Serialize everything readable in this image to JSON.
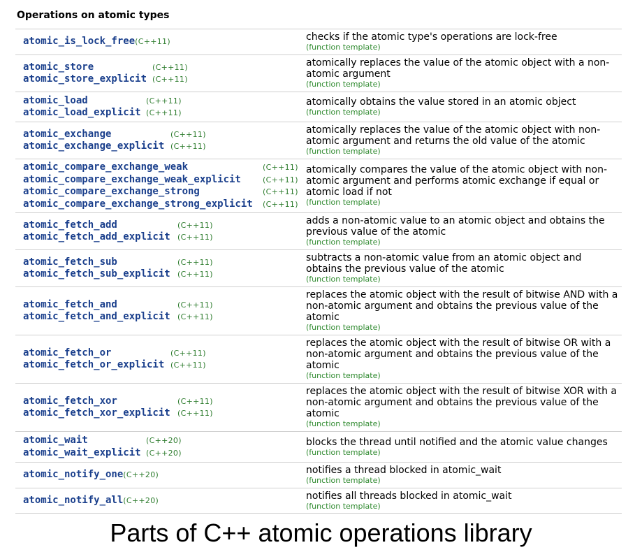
{
  "section_title": "Operations on atomic types",
  "caption": "Parts of C++ atomic operations library",
  "rows": [
    {
      "names": [
        {
          "fn": "atomic_is_lock_free",
          "ver": "(C++11)"
        }
      ],
      "desc": "checks if the atomic type's operations are lock-free",
      "kind": "(function template)"
    },
    {
      "names": [
        {
          "fn": "atomic_store",
          "ver": "(C++11)"
        },
        {
          "fn": "atomic_store_explicit",
          "ver": "(C++11)"
        }
      ],
      "desc": "atomically replaces the value of the atomic object with a non-atomic argument",
      "kind": "(function template)"
    },
    {
      "names": [
        {
          "fn": "atomic_load",
          "ver": "(C++11)"
        },
        {
          "fn": "atomic_load_explicit",
          "ver": "(C++11)"
        }
      ],
      "desc": "atomically obtains the value stored in an atomic object",
      "kind": "(function template)"
    },
    {
      "names": [
        {
          "fn": "atomic_exchange",
          "ver": "(C++11)"
        },
        {
          "fn": "atomic_exchange_explicit",
          "ver": "(C++11)"
        }
      ],
      "desc": "atomically replaces the value of the atomic object with non-atomic argument and returns the old value of the atomic",
      "kind": "(function template)"
    },
    {
      "names": [
        {
          "fn": "atomic_compare_exchange_weak",
          "ver": "(C++11)"
        },
        {
          "fn": "atomic_compare_exchange_weak_explicit",
          "ver": "(C++11)"
        },
        {
          "fn": "atomic_compare_exchange_strong",
          "ver": "(C++11)"
        },
        {
          "fn": "atomic_compare_exchange_strong_explicit",
          "ver": "(C++11)"
        }
      ],
      "desc": "atomically compares the value of the atomic object with non-atomic argument and performs atomic exchange if equal or atomic load if not",
      "kind": "(function template)"
    },
    {
      "names": [
        {
          "fn": "atomic_fetch_add",
          "ver": "(C++11)"
        },
        {
          "fn": "atomic_fetch_add_explicit",
          "ver": "(C++11)"
        }
      ],
      "desc": "adds a non-atomic value to an atomic object and obtains the previous value of the atomic",
      "kind": "(function template)"
    },
    {
      "names": [
        {
          "fn": "atomic_fetch_sub",
          "ver": "(C++11)"
        },
        {
          "fn": "atomic_fetch_sub_explicit",
          "ver": "(C++11)"
        }
      ],
      "desc": "subtracts a non-atomic value from an atomic object and obtains the previous value of the atomic",
      "kind": "(function template)"
    },
    {
      "names": [
        {
          "fn": "atomic_fetch_and",
          "ver": "(C++11)"
        },
        {
          "fn": "atomic_fetch_and_explicit",
          "ver": "(C++11)"
        }
      ],
      "desc": "replaces the atomic object with the result of bitwise AND with a non-atomic argument and obtains the previous value of the atomic",
      "kind": "(function template)"
    },
    {
      "names": [
        {
          "fn": "atomic_fetch_or",
          "ver": "(C++11)"
        },
        {
          "fn": "atomic_fetch_or_explicit",
          "ver": "(C++11)"
        }
      ],
      "desc": "replaces the atomic object with the result of bitwise OR with a non-atomic argument and obtains the previous value of the atomic",
      "kind": "(function template)"
    },
    {
      "names": [
        {
          "fn": "atomic_fetch_xor",
          "ver": "(C++11)"
        },
        {
          "fn": "atomic_fetch_xor_explicit",
          "ver": "(C++11)"
        }
      ],
      "desc": "replaces the atomic object with the result of bitwise XOR with a non-atomic argument and obtains the previous value of the atomic",
      "kind": "(function template)"
    },
    {
      "names": [
        {
          "fn": "atomic_wait",
          "ver": "(C++20)"
        },
        {
          "fn": "atomic_wait_explicit",
          "ver": "(C++20)"
        }
      ],
      "desc": "blocks the thread until notified and the atomic value changes",
      "kind": "(function template)"
    },
    {
      "names": [
        {
          "fn": "atomic_notify_one",
          "ver": "(C++20)"
        }
      ],
      "desc": "notifies a thread blocked in atomic_wait",
      "kind": "(function template)"
    },
    {
      "names": [
        {
          "fn": "atomic_notify_all",
          "ver": "(C++20)"
        }
      ],
      "desc": "notifies all threads blocked in atomic_wait",
      "kind": "(function template)"
    }
  ]
}
